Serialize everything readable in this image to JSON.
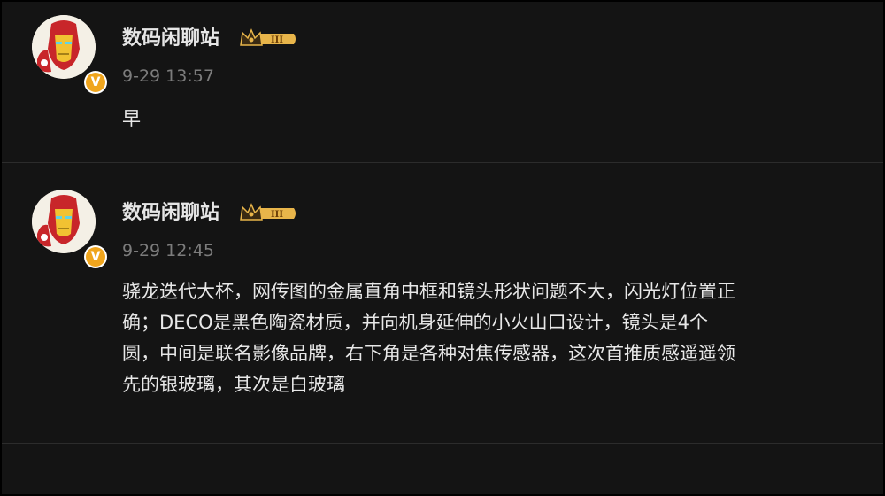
{
  "posts": [
    {
      "author": "数码闲聊站",
      "level_badge": "III",
      "verified_badge": "V",
      "timestamp": "9-29 13:57",
      "content": "早"
    },
    {
      "author": "数码闲聊站",
      "level_badge": "III",
      "verified_badge": "V",
      "timestamp": "9-29 12:45",
      "content": "骁龙迭代大杯，网传图的金属直角中框和镜头形状问题不大，闪光灯位置正\n确；DECO是黑色陶瓷材质，并向机身延伸的小火山口设计，镜头是4个\n圆，中间是联名影像品牌，右下角是各种对焦传感器，这次首推质感遥遥领\n先的银玻璃，其次是白玻璃"
    }
  ],
  "avatar_icon": "iron-man-avatar",
  "colors": {
    "background": "#141414",
    "text": "#e8e8e8",
    "timestamp": "#7c7c7c",
    "verified": "#f0a51d",
    "level_badge": "#e8b54a"
  }
}
